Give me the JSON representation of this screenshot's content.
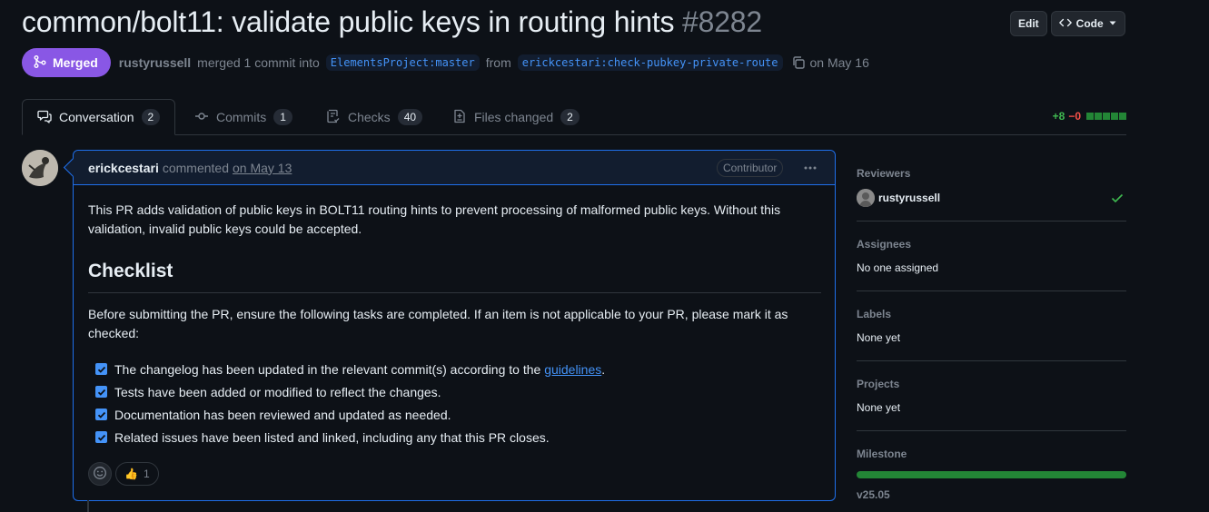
{
  "pr": {
    "title": "common/bolt11: validate public keys in routing hints",
    "number": "#8282",
    "state": "Merged",
    "author": "rustyrussell",
    "merged_text": "merged 1 commit into",
    "base_branch": "ElementsProject:master",
    "from_text": "from",
    "head_branch": "erickcestari:check-pubkey-private-route",
    "merged_date": "on May 16"
  },
  "header_actions": {
    "edit_label": "Edit",
    "code_label": "Code"
  },
  "tabs": [
    {
      "label": "Conversation",
      "count": "2"
    },
    {
      "label": "Commits",
      "count": "1"
    },
    {
      "label": "Checks",
      "count": "40"
    },
    {
      "label": "Files changed",
      "count": "2"
    }
  ],
  "diffstat": {
    "additions": "+8",
    "deletions": "−0"
  },
  "comment": {
    "author": "erickcestari",
    "action": "commented",
    "date": "on May 13",
    "badge": "Contributor",
    "intro": "This PR adds validation of public keys in BOLT11 routing hints to prevent processing of malformed public keys. Without this validation, invalid public keys could be accepted.",
    "heading": "Checklist",
    "paragraph": "Before submitting the PR, ensure the following tasks are completed. If an item is not applicable to your PR, please mark it as checked:",
    "tasks": [
      {
        "text": "The changelog has been updated in the relevant commit(s) according to the ",
        "link": "guidelines",
        "after": "."
      },
      {
        "text": "Tests have been added or modified to reflect the changes."
      },
      {
        "text": "Documentation has been reviewed and updated as needed."
      },
      {
        "text": "Related issues have been listed and linked, including any that this PR closes."
      }
    ],
    "reaction": {
      "emoji": "👍",
      "count": "1"
    }
  },
  "sidebar": {
    "reviewers": {
      "title": "Reviewers",
      "name": "rustyrussell"
    },
    "assignees": {
      "title": "Assignees",
      "value": "No one assigned"
    },
    "labels": {
      "title": "Labels",
      "value": "None yet"
    },
    "projects": {
      "title": "Projects",
      "value": "None yet"
    },
    "milestone": {
      "title": "Milestone",
      "value": "v25.05",
      "progress": 1.0
    }
  },
  "colors": {
    "merged": "#8957e5",
    "accent": "#4493f8",
    "success": "#3fb950",
    "danger": "#f85149"
  }
}
